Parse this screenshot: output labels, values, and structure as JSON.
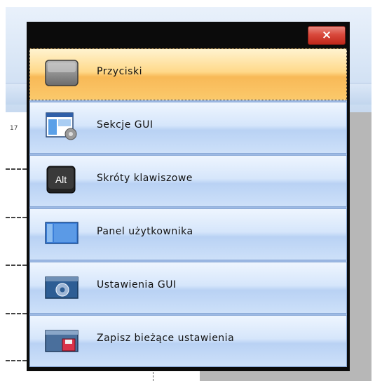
{
  "background": {
    "ruler_number": "17"
  },
  "dialog": {
    "close_label": "×",
    "items": [
      {
        "label": "Przyciski",
        "icon": "button-icon",
        "selected": true
      },
      {
        "label": "Sekcje GUI",
        "icon": "gui-sections-icon",
        "selected": false
      },
      {
        "label": "Skróty klawiszowe",
        "icon": "keyboard-alt-key-icon",
        "icon_text": "Alt",
        "selected": false
      },
      {
        "label": "Panel użytkownika",
        "icon": "user-panel-icon",
        "selected": false
      },
      {
        "label": "Ustawienia GUI",
        "icon": "gui-settings-gear-icon",
        "selected": false
      },
      {
        "label": "Zapisz bieżące ustawienia",
        "icon": "save-settings-floppy-icon",
        "selected": false
      }
    ]
  },
  "colors": {
    "selected_item": "#f8b957",
    "item_blue": "#b9d2f4",
    "close_red": "#d9493c"
  }
}
